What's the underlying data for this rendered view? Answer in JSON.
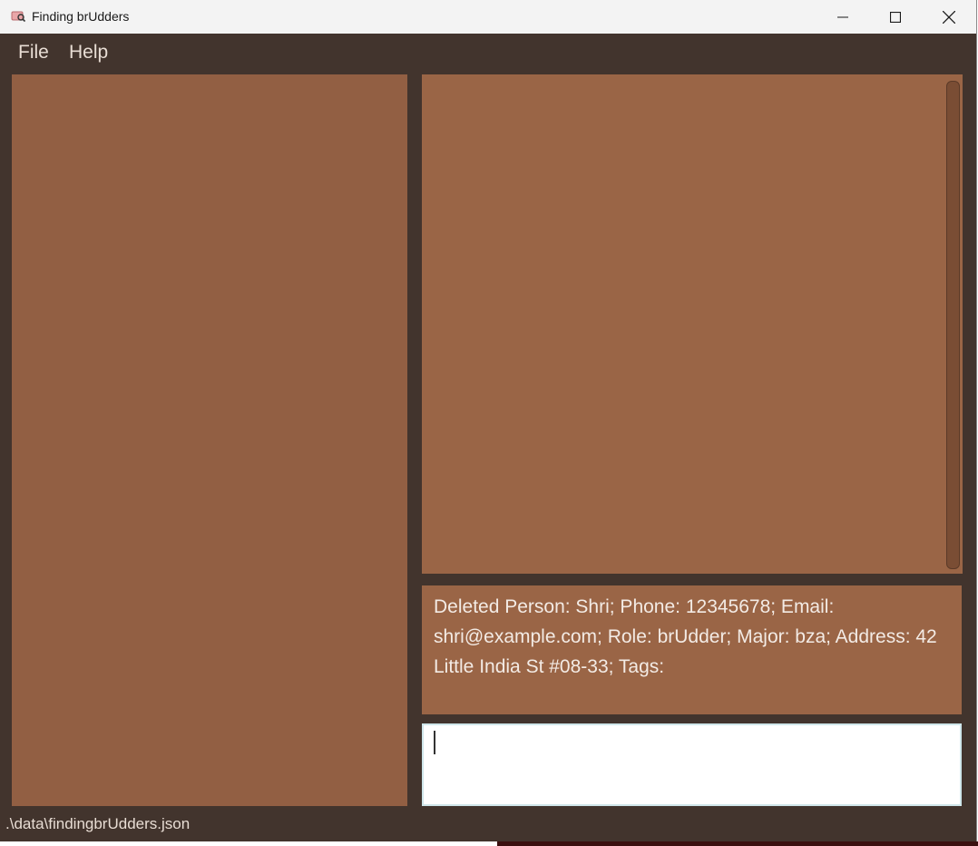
{
  "window": {
    "title": "Finding brUdders"
  },
  "menu": {
    "file_label": "File",
    "help_label": "Help"
  },
  "result_display": {
    "text": "Deleted Person: Shri; Phone: 12345678; Email: shri@example.com; Role: brUdder; Major: bza; Address: 42 Little India St #08-33; Tags:"
  },
  "command_box": {
    "value": ""
  },
  "status_bar": {
    "file_path": ".\\data\\findingbrUdders.json"
  },
  "colors": {
    "window_background": "#42342d",
    "list_panel": "#925f43",
    "display_panel": "#9a6546",
    "text_light": "#e8ddd4"
  }
}
